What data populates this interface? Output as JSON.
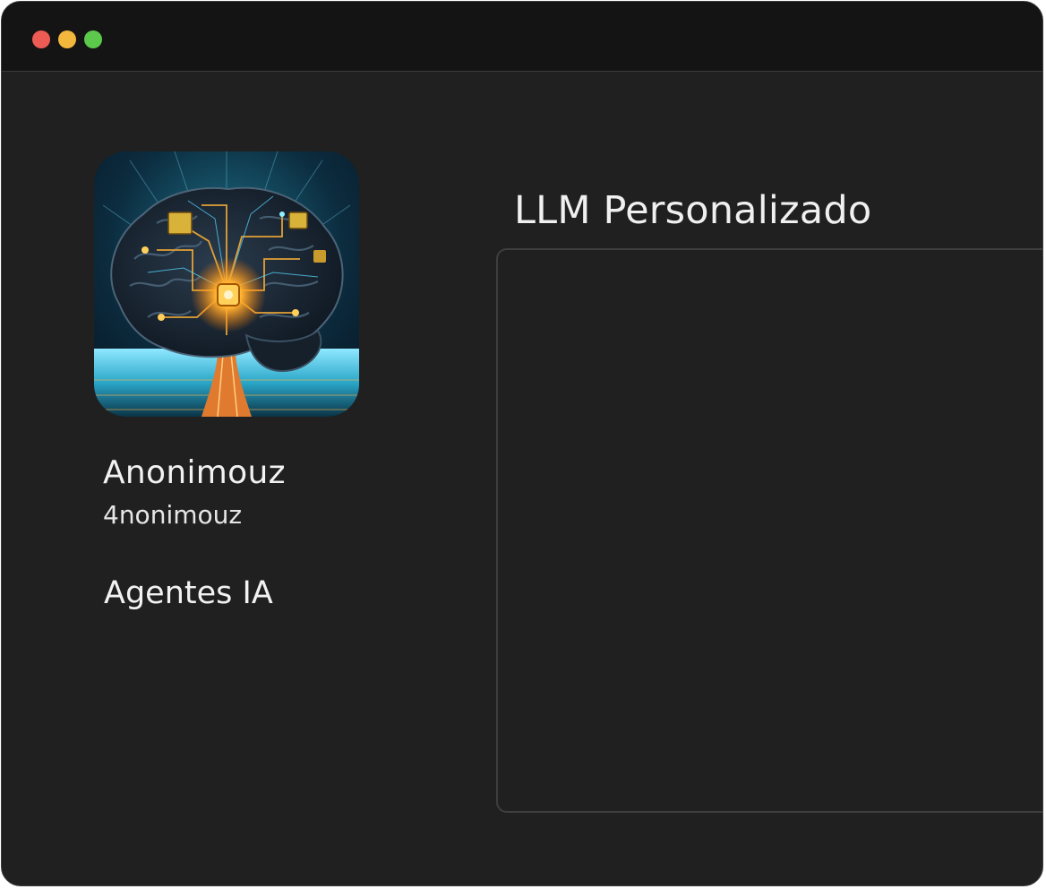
{
  "window": {
    "controls": {
      "close_color": "#ed5b55",
      "minimize_color": "#f3b73d",
      "maximize_color": "#5cc84c"
    }
  },
  "sidebar": {
    "avatar": "brain-circuit-image",
    "profile": {
      "name": "Anonimouz",
      "handle": "4nonimouz"
    },
    "items": [
      {
        "label": "Agentes IA"
      }
    ]
  },
  "main": {
    "title": "LLM Personalizado"
  }
}
